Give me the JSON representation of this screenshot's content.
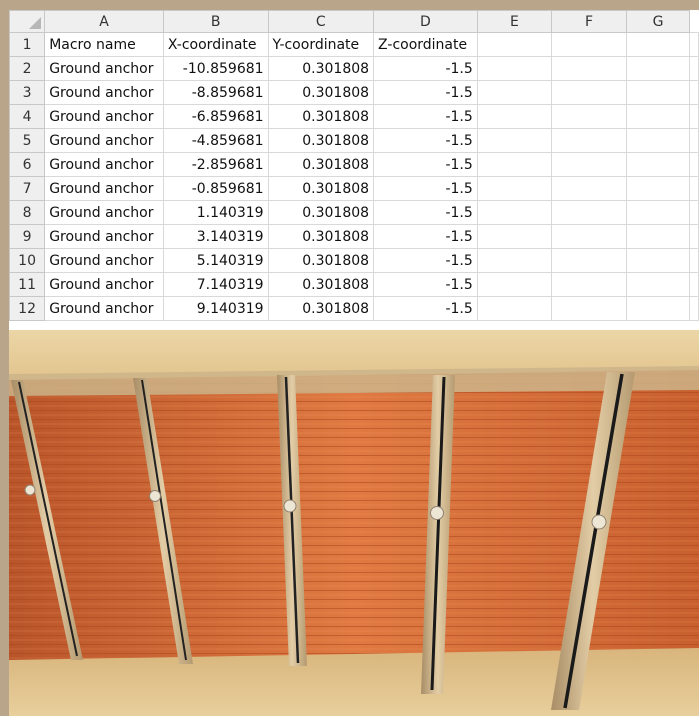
{
  "spreadsheet": {
    "columns": [
      "A",
      "B",
      "C",
      "D",
      "E",
      "F",
      "G"
    ],
    "rows": [
      {
        "num": "1",
        "cells": [
          "Macro name",
          "X-coordinate",
          "Y-coordinate",
          "Z-coordinate",
          "",
          "",
          ""
        ]
      },
      {
        "num": "2",
        "cells": [
          "Ground anchor",
          "-10.859681",
          "0.301808",
          "-1.5",
          "",
          "",
          ""
        ]
      },
      {
        "num": "3",
        "cells": [
          "Ground anchor",
          "-8.859681",
          "0.301808",
          "-1.5",
          "",
          "",
          ""
        ]
      },
      {
        "num": "4",
        "cells": [
          "Ground anchor",
          "-6.859681",
          "0.301808",
          "-1.5",
          "",
          "",
          ""
        ]
      },
      {
        "num": "5",
        "cells": [
          "Ground anchor",
          "-4.859681",
          "0.301808",
          "-1.5",
          "",
          "",
          ""
        ]
      },
      {
        "num": "6",
        "cells": [
          "Ground anchor",
          "-2.859681",
          "0.301808",
          "-1.5",
          "",
          "",
          ""
        ]
      },
      {
        "num": "7",
        "cells": [
          "Ground anchor",
          "-0.859681",
          "0.301808",
          "-1.5",
          "",
          "",
          ""
        ]
      },
      {
        "num": "8",
        "cells": [
          "Ground anchor",
          "1.140319",
          "0.301808",
          "-1.5",
          "",
          "",
          ""
        ]
      },
      {
        "num": "9",
        "cells": [
          "Ground anchor",
          "3.140319",
          "0.301808",
          "-1.5",
          "",
          "",
          ""
        ]
      },
      {
        "num": "10",
        "cells": [
          "Ground anchor",
          "5.140319",
          "0.301808",
          "-1.5",
          "",
          "",
          ""
        ]
      },
      {
        "num": "11",
        "cells": [
          "Ground anchor",
          "7.140319",
          "0.301808",
          "-1.5",
          "",
          "",
          ""
        ]
      },
      {
        "num": "12",
        "cells": [
          "Ground anchor",
          "9.140319",
          "0.301808",
          "-1.5",
          "",
          "",
          ""
        ]
      }
    ]
  },
  "colors": {
    "soil": "#e2c48d",
    "sheet_pile": "#d8743f",
    "waler": "#cdb289",
    "header_bg": "#efefef",
    "frame": "#b9a58a"
  }
}
